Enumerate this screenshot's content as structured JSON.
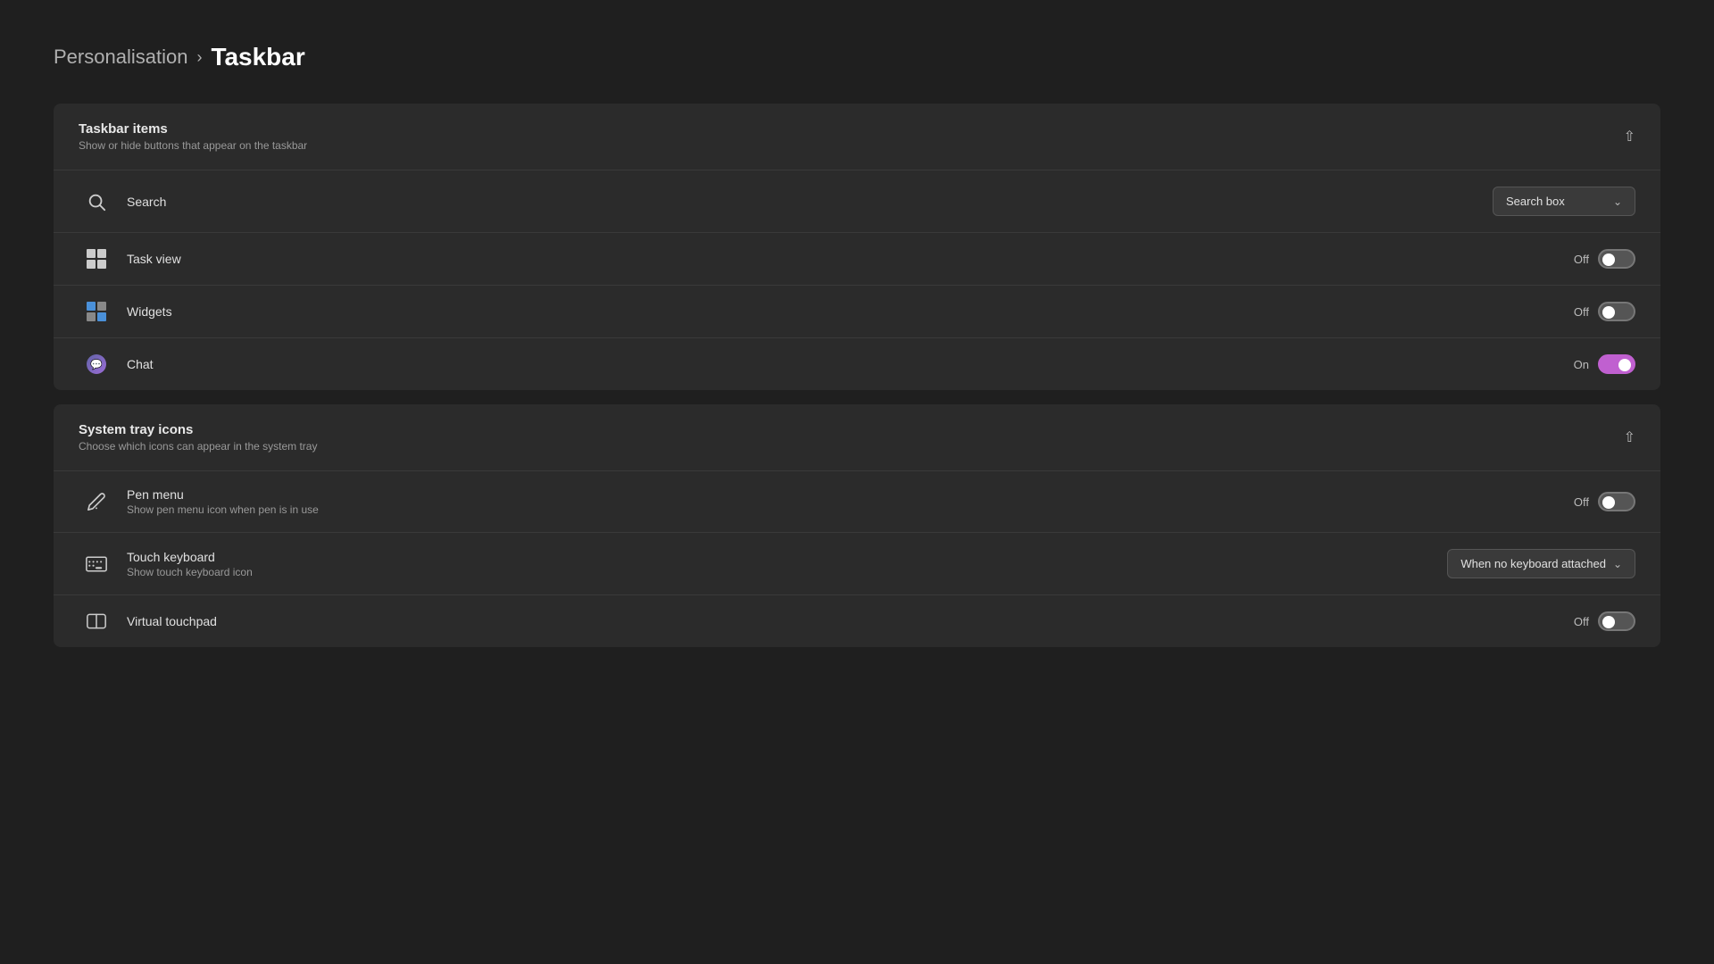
{
  "breadcrumb": {
    "parent": "Personalisation",
    "separator": "›",
    "current": "Taskbar"
  },
  "taskbar_items_section": {
    "title": "Taskbar items",
    "subtitle": "Show or hide buttons that appear on the taskbar",
    "items": [
      {
        "id": "search",
        "icon": "search",
        "label": "Search",
        "control_type": "dropdown",
        "dropdown_value": "Search box"
      },
      {
        "id": "task_view",
        "icon": "task-view",
        "label": "Task view",
        "control_type": "toggle",
        "toggle_state": "off",
        "toggle_label": "Off"
      },
      {
        "id": "widgets",
        "icon": "widgets",
        "label": "Widgets",
        "control_type": "toggle",
        "toggle_state": "off",
        "toggle_label": "Off"
      },
      {
        "id": "chat",
        "icon": "chat",
        "label": "Chat",
        "control_type": "toggle",
        "toggle_state": "on",
        "toggle_label": "On"
      }
    ]
  },
  "system_tray_section": {
    "title": "System tray icons",
    "subtitle": "Choose which icons can appear in the system tray",
    "items": [
      {
        "id": "pen_menu",
        "icon": "pen",
        "label": "Pen menu",
        "sublabel": "Show pen menu icon when pen is in use",
        "control_type": "toggle",
        "toggle_state": "off",
        "toggle_label": "Off"
      },
      {
        "id": "touch_keyboard",
        "icon": "keyboard",
        "label": "Touch keyboard",
        "sublabel": "Show touch keyboard icon",
        "control_type": "dropdown",
        "dropdown_value": "When no keyboard attached"
      },
      {
        "id": "virtual_touchpad",
        "icon": "touchpad",
        "label": "Virtual touchpad",
        "sublabel": "",
        "control_type": "toggle",
        "toggle_state": "off",
        "toggle_label": "Off"
      }
    ]
  }
}
